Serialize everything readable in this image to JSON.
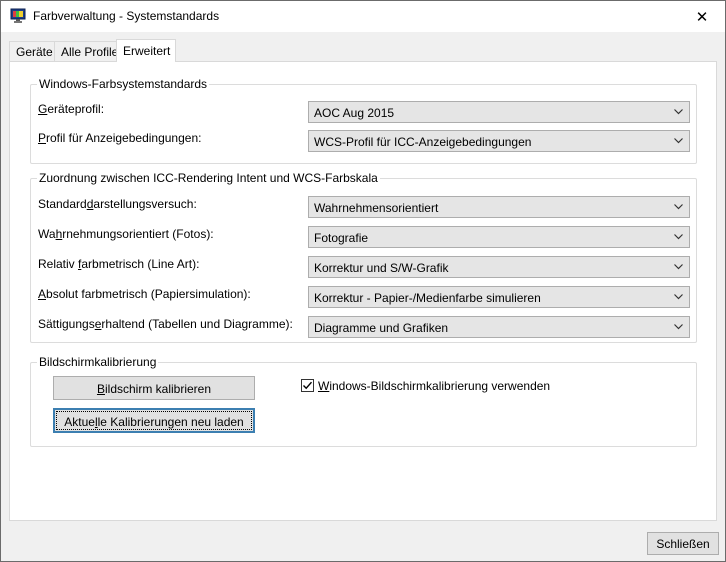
{
  "window": {
    "title": "Farbverwaltung - Systemstandards",
    "close_glyph": "✕"
  },
  "tabs": [
    {
      "label": "Geräte",
      "active": false
    },
    {
      "label": "Alle Profile",
      "active": false
    },
    {
      "label": "Erweitert",
      "active": true
    }
  ],
  "groups": {
    "defaults": {
      "title": "Windows-Farbsystemstandards",
      "rows": [
        {
          "label_pre": "",
          "label_ul": "G",
          "label_post": "eräteprofil:",
          "value": "AOC Aug 2015"
        },
        {
          "label_pre": "",
          "label_ul": "P",
          "label_post": "rofil für Anzeigebedingungen:",
          "value": "WCS-Profil für ICC-Anzeigebedingungen"
        }
      ]
    },
    "mapping": {
      "title": "Zuordnung zwischen ICC-Rendering Intent und WCS-Farbskala",
      "rows": [
        {
          "label_pre": "Standard",
          "label_ul": "d",
          "label_post": "arstellungsversuch:",
          "value": "Wahrnehmensorientiert"
        },
        {
          "label_pre": "Wa",
          "label_ul": "h",
          "label_post": "rnehmungsorientiert (Fotos):",
          "value": "Fotografie"
        },
        {
          "label_pre": "Relativ ",
          "label_ul": "f",
          "label_post": "arbmetrisch (Line Art):",
          "value": "Korrektur und S/W-Grafik"
        },
        {
          "label_pre": "",
          "label_ul": "A",
          "label_post": "bsolut farbmetrisch (Papiersimulation):",
          "value": "Korrektur - Papier-/Medienfarbe simulieren"
        },
        {
          "label_pre": "Sättigungs",
          "label_ul": "e",
          "label_post": "rhaltend (Tabellen und Diagramme):",
          "value": "Diagramme und Grafiken"
        }
      ]
    },
    "calibration": {
      "title": "Bildschirmkalibrierung",
      "calibrate_pre": "",
      "calibrate_ul": "B",
      "calibrate_post": "ildschirm kalibrieren",
      "reload_pre": "Aktue",
      "reload_ul": "l",
      "reload_post": "le Kalibrierungen neu laden",
      "checkbox_pre": "",
      "checkbox_ul": "W",
      "checkbox_post": "indows-Bildschirmkalibrierung verwenden",
      "checkbox_checked": true
    }
  },
  "footer": {
    "close_label": "Schließen"
  },
  "colors": {
    "accent_border": "#3c7fb1",
    "checkbox_check": "#000000"
  }
}
